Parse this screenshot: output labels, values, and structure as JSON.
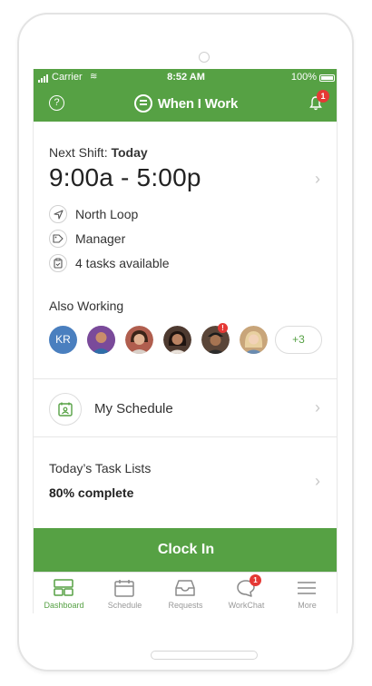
{
  "status_bar": {
    "carrier": "Carrier",
    "time": "8:52 AM",
    "battery": "100%"
  },
  "header": {
    "app_name": "When I Work",
    "help_icon": "?",
    "notification_count": "1"
  },
  "shift": {
    "label": "Next Shift: ",
    "day": "Today",
    "time_range": "9:00a - 5:00p",
    "location": "North Loop",
    "position": "Manager",
    "tasks": "4 tasks available"
  },
  "also_working": {
    "label": "Also Working",
    "avatars": [
      {
        "initials": "KR",
        "color": "#4a7fbf"
      },
      {
        "color": "#7a4a9a"
      },
      {
        "color": "#b05e4e"
      },
      {
        "color": "#4e3a30"
      },
      {
        "color": "#5a4538"
      },
      {
        "color": "#c8a57a"
      }
    ],
    "avatar_badge": "!",
    "more_count": "+3"
  },
  "schedule": {
    "label": "My Schedule"
  },
  "task_lists": {
    "title": "Today’s Task Lists",
    "progress": "80% complete",
    "progress_value": 0.8
  },
  "clock_in": {
    "label": "Clock In"
  },
  "tabs": [
    {
      "label": "Dashboard",
      "icon": "dashboard-icon",
      "active": true
    },
    {
      "label": "Schedule",
      "icon": "calendar-icon",
      "active": false
    },
    {
      "label": "Requests",
      "icon": "inbox-icon",
      "active": false
    },
    {
      "label": "WorkChat",
      "icon": "chat-icon",
      "active": false,
      "badge": "1"
    },
    {
      "label": "More",
      "icon": "menu-icon",
      "active": false
    }
  ],
  "colors": {
    "accent": "#56a144",
    "badge": "#e53935",
    "chevron": "#c8c8c8"
  }
}
